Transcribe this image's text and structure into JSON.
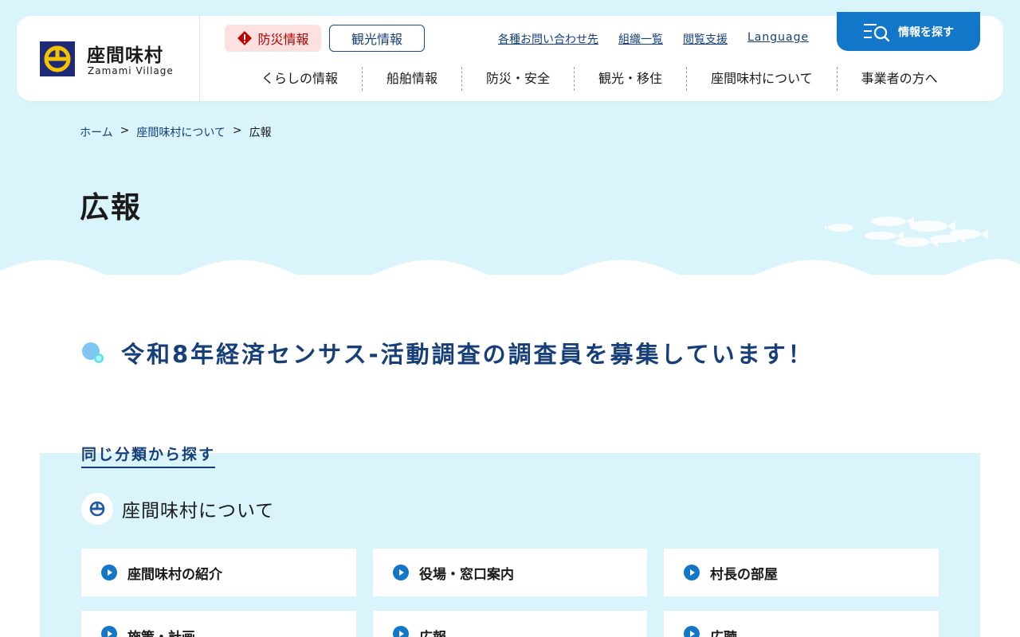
{
  "header": {
    "logo_name": "座間味村",
    "logo_sub": "Zamami Village",
    "bousai_label": "防災情報",
    "kanko_label": "観光情報",
    "util_links": [
      "各種お問い合わせ先",
      "組織一覧",
      "閲覧支援",
      "Language"
    ],
    "search_label": "情報を探す",
    "nav": [
      "くらしの情報",
      "船舶情報",
      "防災・安全",
      "観光・移住",
      "座間味村について",
      "事業者の方へ"
    ]
  },
  "breadcrumb": {
    "items": [
      "ホーム",
      "座間味村について",
      "広報"
    ],
    "separator": ">"
  },
  "page": {
    "title": "広報",
    "article_title": "令和8年経済センサス-活動調査の調査員を募集しています！"
  },
  "category": {
    "label": "同じ分類から探す",
    "heading": "座間味村について",
    "cards": [
      "座間味村の紹介",
      "役場・窓口案内",
      "村長の部屋",
      "施策・計画",
      "広報",
      "広聴"
    ]
  },
  "colors": {
    "hero_bg": "#d9f4fa",
    "brand_blue": "#163f7a",
    "accent_blue": "#1377c9",
    "warning_red": "#b20000",
    "warning_bg": "#fde0e0",
    "logo_navy": "#1e2a78",
    "logo_yellow": "#f5c400"
  },
  "icons": {
    "warning": "warning-diamond-icon",
    "search": "menu-search-icon",
    "bubble": "bubble-icon",
    "village": "village-emblem-icon",
    "card": "play-circle-icon"
  }
}
